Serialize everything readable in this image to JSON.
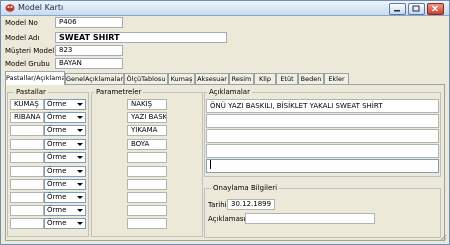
{
  "window": {
    "title": "Model Kartı"
  },
  "fields": {
    "model_no": {
      "label": "Model No",
      "value": "P406"
    },
    "model_adi": {
      "label": "Model Adı",
      "value": "SWEAT SHIRT"
    },
    "musteri_model_no": {
      "label": "Müşteri Model No",
      "value": "823"
    },
    "model_grubu": {
      "label": "Model Grubu",
      "value": "BAYAN"
    }
  },
  "tabs": [
    "Pastallar/Açıklama",
    "GenelAçıklamalar",
    "ÖlçüTablosu",
    "Kumaş",
    "Aksesuar",
    "Resim",
    "Klip",
    "Etüt",
    "Beden",
    "Ekler"
  ],
  "pastallar": {
    "title": "Pastallar",
    "rows": [
      {
        "name": "KUMAŞ",
        "type": "Örme"
      },
      {
        "name": "RİBANA",
        "type": "Örme"
      },
      {
        "name": "",
        "type": "Örme"
      },
      {
        "name": "",
        "type": "Örme"
      },
      {
        "name": "",
        "type": "Örme"
      },
      {
        "name": "",
        "type": "Örme"
      },
      {
        "name": "",
        "type": "Örme"
      },
      {
        "name": "",
        "type": "Örme"
      },
      {
        "name": "",
        "type": "Örme"
      },
      {
        "name": "",
        "type": "Örme"
      }
    ]
  },
  "parametreler": {
    "title": "Parametreler",
    "rows": [
      "NAKIŞ",
      "YAZI BASKI",
      "YIKAMA",
      "BOYA",
      "",
      "",
      "",
      "",
      "",
      ""
    ]
  },
  "aciklamalar": {
    "title": "Açıklamalar",
    "lines": [
      "ÖNÜ YAZI BASKILI, BİSİKLET YAKALI SWEAT SHİRT",
      "",
      "",
      "",
      ""
    ]
  },
  "onaylama": {
    "title": "Onaylama Bilgileri",
    "tarihi_label": "Tarihi",
    "tarihi_value": "30.12.1899",
    "aciklama_label": "Açıklaması",
    "aciklama_value": ""
  }
}
